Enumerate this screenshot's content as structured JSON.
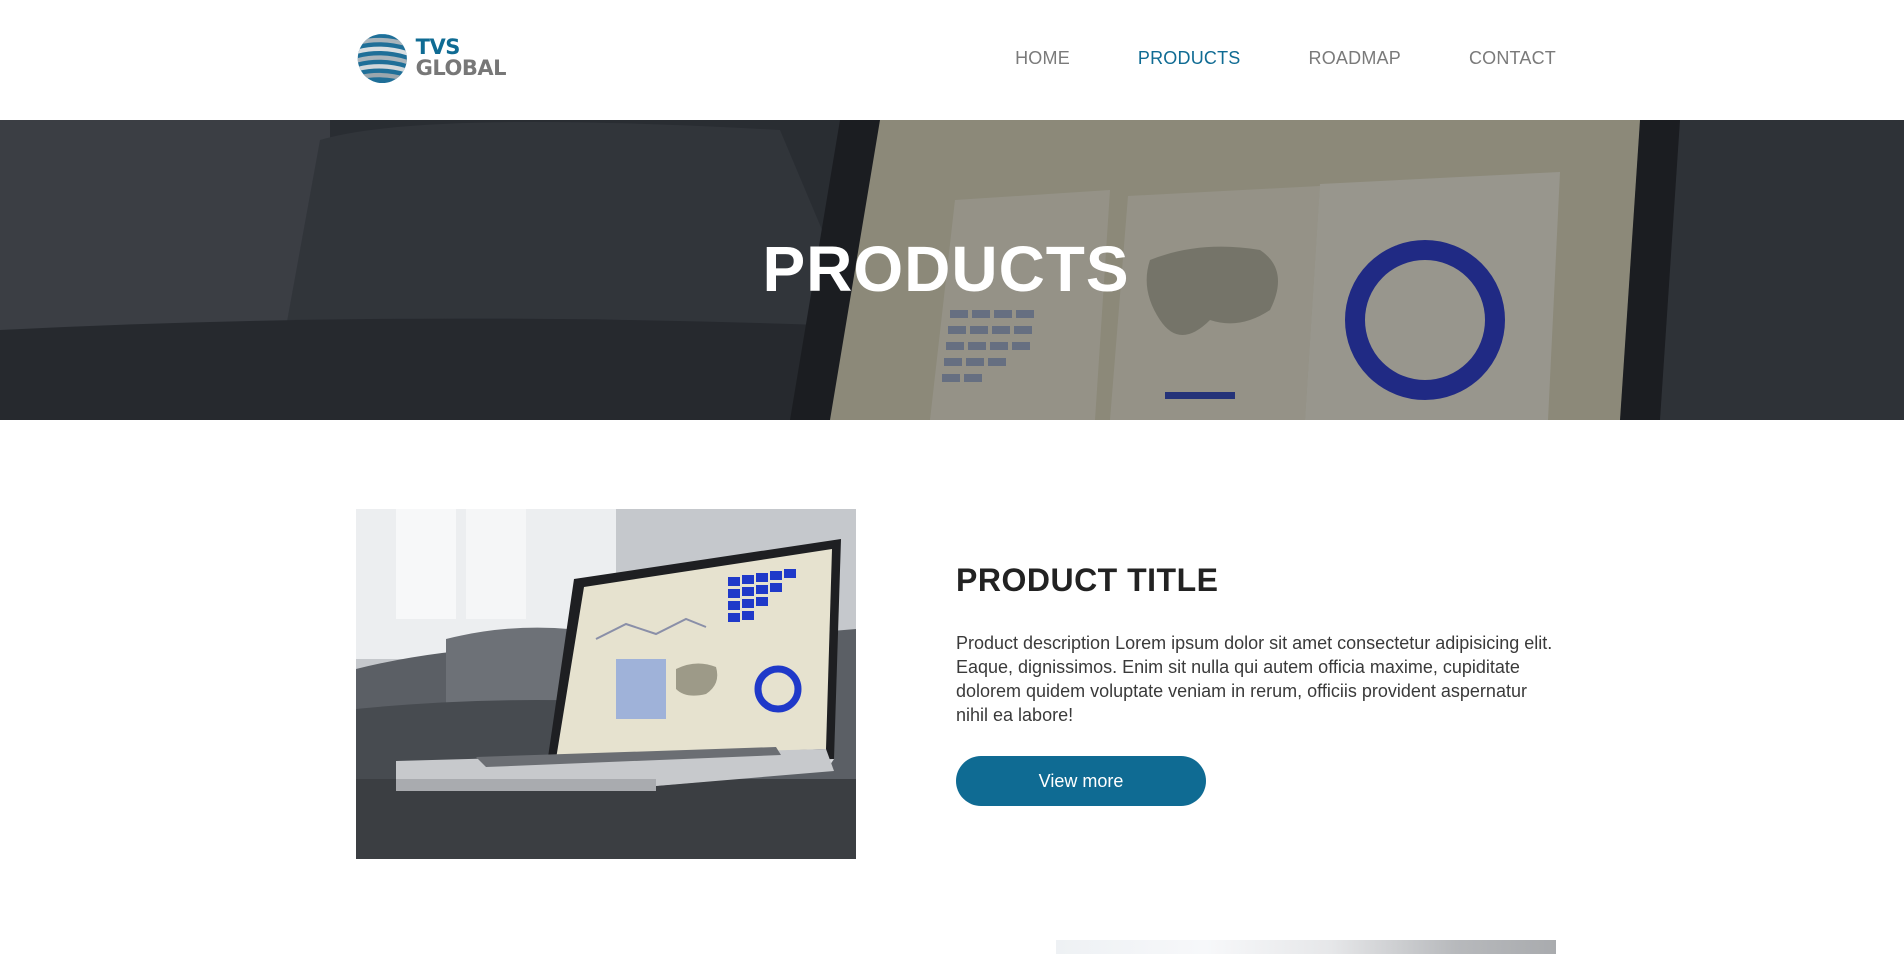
{
  "header": {
    "logo": {
      "line1": "TVS",
      "line2": "GLOBAL"
    },
    "nav": [
      {
        "label": "HOME",
        "active": false
      },
      {
        "label": "PRODUCTS",
        "active": true
      },
      {
        "label": "ROADMAP",
        "active": false
      },
      {
        "label": "CONTACT",
        "active": false
      }
    ]
  },
  "hero": {
    "title": "PRODUCTS"
  },
  "product": {
    "title": "PRODUCT TITLE",
    "description": "Product description Lorem ipsum dolor sit amet consectetur adipisicing elit. Eaque, dignissimos. Enim sit nulla qui autem officia maxime, cupiditate dolorem quidem voluptate veniam in rerum, officiis provident aspernatur nihil ea labore!",
    "button_label": "View more"
  },
  "colors": {
    "brand": "#0f6b93",
    "nav_text": "#7a7a7a",
    "title_text": "#222222"
  }
}
